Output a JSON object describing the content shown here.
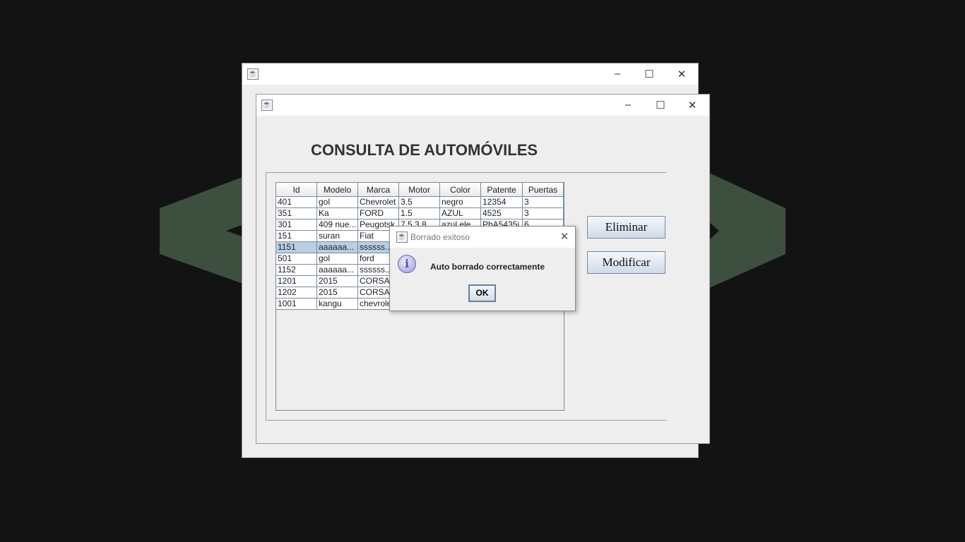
{
  "outer_window": {
    "title": ""
  },
  "main_window": {
    "title": "",
    "heading": "CONSULTA DE AUTOMÓVILES"
  },
  "table": {
    "columns": [
      "Id",
      "Modelo",
      "Marca",
      "Motor",
      "Color",
      "Patente",
      "Puertas"
    ],
    "rows": [
      [
        "401",
        "gol",
        "Chevrolet",
        "3.5",
        "negro",
        "12354",
        "3"
      ],
      [
        "351",
        "Ka",
        "FORD",
        "1.5",
        "AZUL",
        "4525",
        "3"
      ],
      [
        "301",
        "409 nue...",
        "Peugotsk",
        "7.5 3.8",
        "azul ele...",
        "PhA5435i",
        "6"
      ],
      [
        "151",
        "suran",
        "Fiat",
        "",
        "",
        "",
        ""
      ],
      [
        "1151",
        "aaaaaa...",
        "ssssss...",
        "",
        "",
        "",
        ""
      ],
      [
        "501",
        "gol",
        "ford",
        "",
        "",
        "",
        ""
      ],
      [
        "1152",
        "aaaaaa...",
        "ssssss...",
        "",
        "",
        "",
        ""
      ],
      [
        "1201",
        "2015",
        "CORSA",
        "",
        "",
        "",
        ""
      ],
      [
        "1202",
        "2015",
        "CORSA",
        "",
        "",
        "",
        ""
      ],
      [
        "1001",
        "kangu",
        "chevrolet",
        "",
        "",
        "",
        ""
      ]
    ],
    "selected_row": 4
  },
  "buttons": {
    "delete": "Eliminar",
    "modify": "Modificar"
  },
  "dialog": {
    "title": "Borrado exitoso",
    "message": "Auto borrado correctamente",
    "ok": "OK"
  },
  "colors": {
    "background": "#131313",
    "shape": "#3d4f3e",
    "selection": "#b8cfe5"
  }
}
